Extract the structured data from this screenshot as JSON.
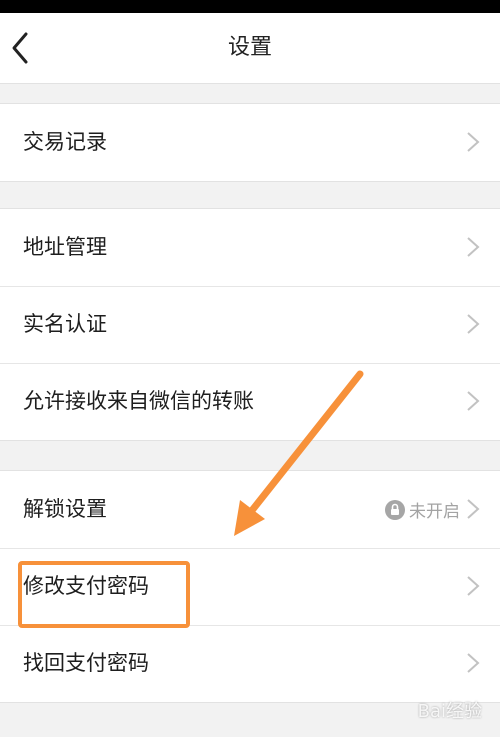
{
  "header": {
    "title": "设置",
    "back_icon": "chevron-left-icon"
  },
  "groups": [
    {
      "rows": [
        {
          "label": "交易记录"
        }
      ]
    },
    {
      "rows": [
        {
          "label": "地址管理"
        },
        {
          "label": "实名认证"
        },
        {
          "label": "允许接收来自微信的转账"
        }
      ]
    },
    {
      "rows": [
        {
          "label": "解锁设置",
          "status": "未开启",
          "status_icon": "lock-icon"
        },
        {
          "label": "修改支付密码",
          "highlighted": true
        },
        {
          "label": "找回支付密码"
        }
      ]
    }
  ],
  "annotation": {
    "arrow_color": "#f7913a",
    "box_color": "#f7913a"
  },
  "watermark": {
    "text": "Bai经验"
  },
  "colors": {
    "background": "#f2f2f2",
    "row": "#ffffff",
    "chevron": "#c2c2c2",
    "status_text": "#a3a3a3"
  }
}
